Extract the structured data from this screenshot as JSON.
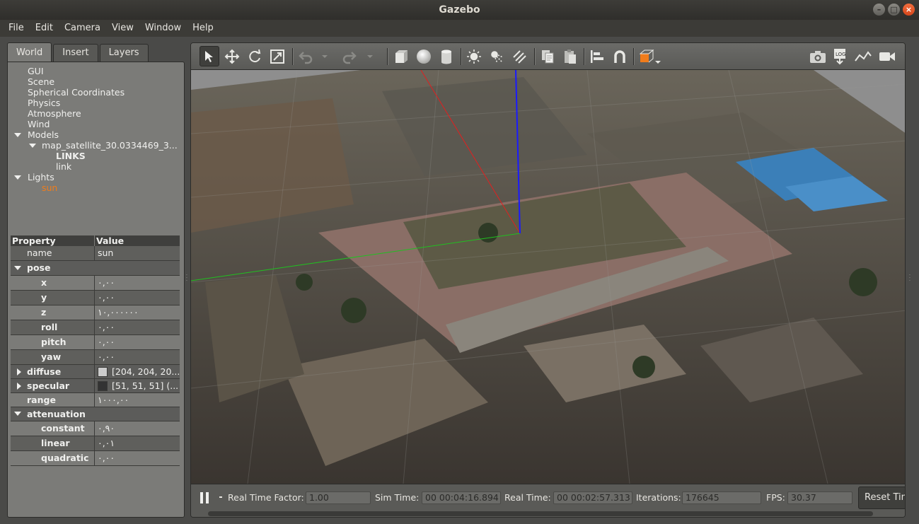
{
  "window": {
    "title": "Gazebo"
  },
  "window_controls": {
    "minimize": "–",
    "maximize": "□",
    "close": "×"
  },
  "menu": [
    "File",
    "Edit",
    "Camera",
    "View",
    "Window",
    "Help"
  ],
  "left_panel": {
    "tabs": [
      "World",
      "Insert",
      "Layers"
    ],
    "active_tab": "World",
    "tree": {
      "gui": "GUI",
      "scene": "Scene",
      "spherical": "Spherical Coordinates",
      "physics": "Physics",
      "atmosphere": "Atmosphere",
      "wind": "Wind",
      "models": "Models",
      "model_name": "map_satellite_30.0334469_3...",
      "links_header": "LINKS",
      "link": "link",
      "lights": "Lights",
      "sun": "sun"
    },
    "divider": "......",
    "properties": {
      "header_property": "Property",
      "header_value": "Value",
      "name_label": "name",
      "name_value": "sun",
      "pose_label": "pose",
      "x_label": "x",
      "x_value": "٠,٠٠",
      "y_label": "y",
      "y_value": "٠,٠٠",
      "z_label": "z",
      "z_value": "١٠,٠٠٠٠٠٠",
      "roll_label": "roll",
      "roll_value": "٠,٠٠",
      "pitch_label": "pitch",
      "pitch_value": "٠,٠٠",
      "yaw_label": "yaw",
      "yaw_value": "٠,٠٠",
      "diffuse_label": "diffuse",
      "diffuse_value": "[204, 204, 20...",
      "diffuse_color": "#cccccc",
      "specular_label": "specular",
      "specular_value": "[51, 51, 51] (...",
      "specular_color": "#333333",
      "range_label": "range",
      "range_value": "١٠٠٠,٠٠",
      "attenuation_label": "attenuation",
      "constant_label": "constant",
      "constant_value": "٠,٩٠",
      "linear_label": "linear",
      "linear_value": "٠,٠١",
      "quadratic_label": "quadratic",
      "quadratic_value": "٠,٠٠"
    }
  },
  "toolbar": {
    "icons": [
      "select-mode-icon",
      "translate-mode-icon",
      "rotate-mode-icon",
      "scale-mode-icon",
      "undo-icon",
      "undo-history-icon",
      "redo-icon",
      "redo-history-icon",
      "box-shape-icon",
      "sphere-shape-icon",
      "cylinder-shape-icon",
      "point-light-icon",
      "spot-light-icon",
      "directional-light-icon",
      "copy-icon",
      "paste-icon",
      "align-icon",
      "snap-icon",
      "view-angle-icon",
      "screenshot-icon",
      "log-icon",
      "plot-icon",
      "video-record-icon"
    ]
  },
  "status": {
    "real_time_factor_label": "Real Time Factor:",
    "real_time_factor": "1.00",
    "sim_time_label": "Sim Time:",
    "sim_time": "00 00:04:16.894",
    "real_time_label": "Real Time:",
    "real_time": "00 00:02:57.313",
    "iterations_label": "Iterations:",
    "iterations": "176645",
    "fps_label": "FPS:",
    "fps": "30.37",
    "reset_label": "Reset Time"
  },
  "colors": {
    "selected_tree_item": "#f07c1b",
    "x_axis": "#e02020",
    "y_axis": "#20c020",
    "z_axis": "#1a1aff"
  }
}
